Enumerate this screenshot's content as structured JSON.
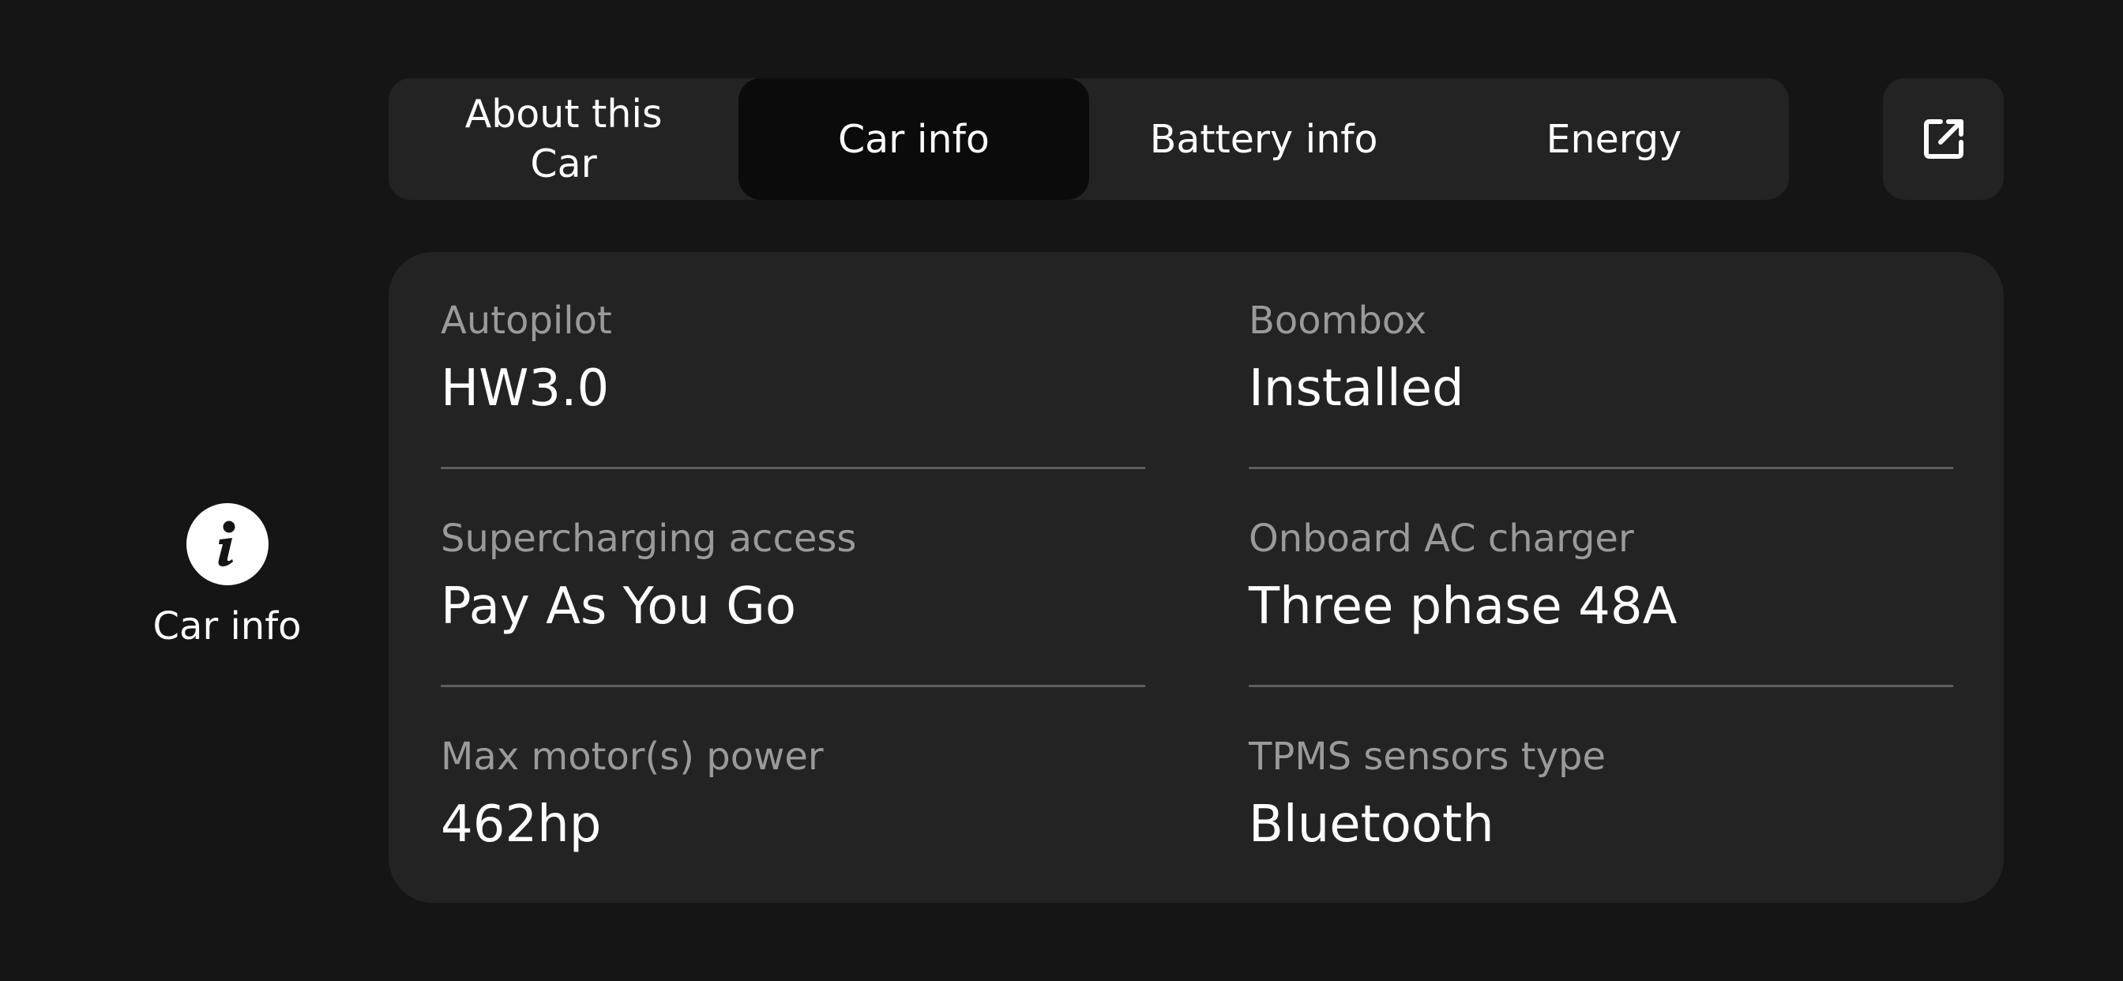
{
  "side": {
    "icon": "info-icon",
    "label": "Car info"
  },
  "tabs": [
    {
      "label": "About this Car",
      "active": false
    },
    {
      "label": "Car info",
      "active": true
    },
    {
      "label": "Battery info",
      "active": false
    },
    {
      "label": "Energy",
      "active": false
    }
  ],
  "popout_button": {
    "icon": "open-external-icon"
  },
  "info": {
    "autopilot": {
      "label": "Autopilot",
      "value": "HW3.0"
    },
    "boombox": {
      "label": "Boombox",
      "value": "Installed"
    },
    "supercharging": {
      "label": "Supercharging access",
      "value": "Pay As You Go"
    },
    "ac_charger": {
      "label": "Onboard AC charger",
      "value": "Three phase 48A"
    },
    "motor_power": {
      "label": "Max motor(s) power",
      "value": "462hp"
    },
    "tpms": {
      "label": "TPMS sensors type",
      "value": "Bluetooth"
    }
  },
  "colors": {
    "background": "#151515",
    "surface": "#232323",
    "active_tab": "#0b0b0b",
    "label_text": "#9a9a9a",
    "divider": "#5e5e5e"
  }
}
